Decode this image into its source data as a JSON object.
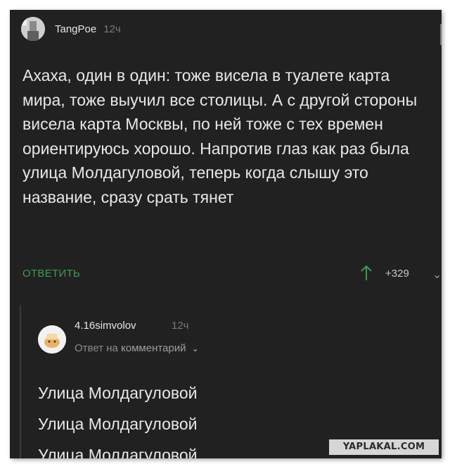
{
  "post": {
    "author": "TangPoe",
    "time": "12ч",
    "body": "Ахаха, один в один: тоже висела в туалете карта мира, тоже выучил все столицы. А с другой стороны висела карта Москвы, по ней тоже с тех времен ориентируюсь хорошо. Напротив глаз как раз была улица Молдагуловой, теперь когда слышу это название, сразу срать тянет",
    "reply_label": "ОТВЕТИТЬ",
    "votes": "+329"
  },
  "reply": {
    "author": "4.16simvolov",
    "time": "12ч",
    "meta_prefix": "Ответ на",
    "meta_link": "комментарий",
    "lines": [
      "Улица Молдагуловой",
      "Улица Молдагуловой",
      "Улица Молдагуловой"
    ]
  },
  "watermark": "YAPLAKAL.COM",
  "colors": {
    "background": "#212121",
    "accent": "#3d9b52",
    "text": "#e8e8e8",
    "muted": "#7a7a7a"
  },
  "icons": {
    "vote_up": "arrow-up-icon",
    "chevron": "chevron-down-icon"
  }
}
